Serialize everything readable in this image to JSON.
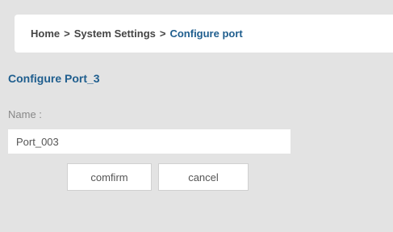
{
  "breadcrumb": {
    "items": [
      "Home",
      "System Settings",
      "Configure port"
    ],
    "separator": ">"
  },
  "form": {
    "title": "Configure Port_3",
    "name_label": "Name :",
    "name_value": "Port_003"
  },
  "buttons": {
    "confirm_label": "comfirm",
    "cancel_label": "cancel"
  },
  "colors": {
    "accent": "#1f5e8e",
    "background": "#e3e3e3",
    "panel": "#ffffff",
    "text": "#454545"
  }
}
